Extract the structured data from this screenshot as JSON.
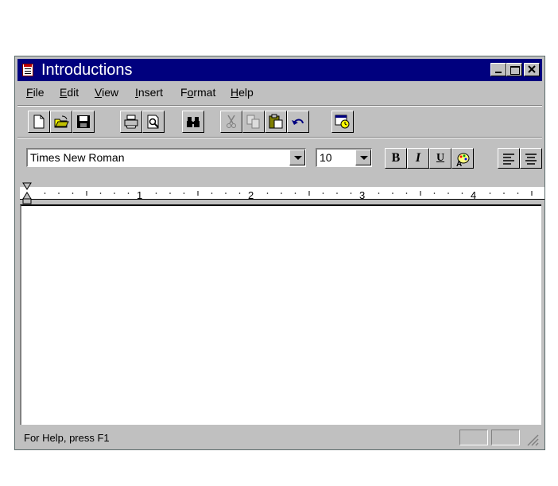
{
  "window": {
    "title": "Introductions"
  },
  "menu": [
    {
      "label": "File",
      "mnemonic": "F",
      "rest": "ile"
    },
    {
      "label": "Edit",
      "mnemonic": "E",
      "rest": "dit"
    },
    {
      "label": "View",
      "mnemonic": "V",
      "rest": "iew"
    },
    {
      "label": "Insert",
      "mnemonic": "I",
      "rest": "nsert"
    },
    {
      "label": "Format",
      "pre": "F",
      "mnemonic": "o",
      "rest": "rmat"
    },
    {
      "label": "Help",
      "mnemonic": "H",
      "rest": "elp"
    }
  ],
  "toolbar": {
    "icons": [
      "new-document-icon",
      "open-folder-icon",
      "save-disk-icon",
      "print-icon",
      "print-preview-icon",
      "find-binoculars-icon",
      "cut-scissors-icon",
      "copy-icon",
      "paste-clipboard-icon",
      "undo-icon",
      "insert-datetime-icon"
    ]
  },
  "format": {
    "font": "Times New Roman",
    "size": "10",
    "bold": "B",
    "italic": "I",
    "underline": "U"
  },
  "ruler": {
    "numbers": [
      "1",
      "2",
      "3",
      "4"
    ]
  },
  "status": {
    "text": "For Help, press F1"
  },
  "colors": {
    "titlebar": "#00007e",
    "face": "#c0c0c0",
    "editor": "#ffffff"
  }
}
